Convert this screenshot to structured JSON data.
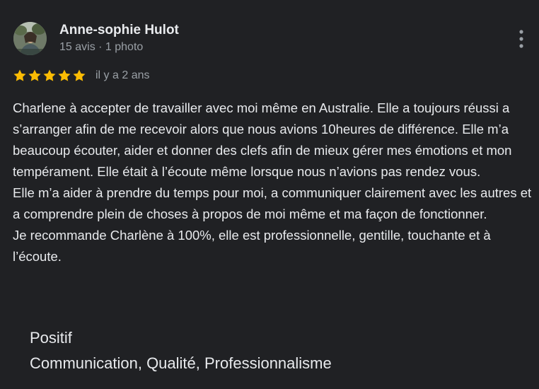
{
  "review": {
    "author": {
      "name": "Anne-sophie Hulot",
      "meta": "15 avis · 1 photo"
    },
    "rating": 5,
    "date": "il y a 2 ans",
    "paragraphs": [
      "Charlene à accepter de travailler avec moi même en Australie. Elle a toujours réussi a s’arranger afin de me recevoir alors que nous avions 10heures de différence. Elle m’a beaucoup écouter, aider et donner des clefs afin de mieux gérer mes émotions et mon tempérament. Elle était à l’écoute même lorsque nous n’avions pas rendez vous.",
      "Elle m’a aider à prendre du temps pour moi, a communiquer clairement avec les autres et a comprendre plein de choses à propos de moi même et ma façon de fonctionner.",
      "Je recommande Charlène à 100%, elle est professionnelle, gentille, touchante et à l’écoute."
    ],
    "attributes": {
      "label": "Positif",
      "value": "Communication, Qualité, Professionnalisme"
    }
  },
  "colors": {
    "background": "#202124",
    "text_primary": "#e8eaed",
    "text_secondary": "#9aa0a6",
    "star": "#fbbc04"
  },
  "icons": {
    "more": "more-vert-icon",
    "star": "star-filled-icon"
  }
}
